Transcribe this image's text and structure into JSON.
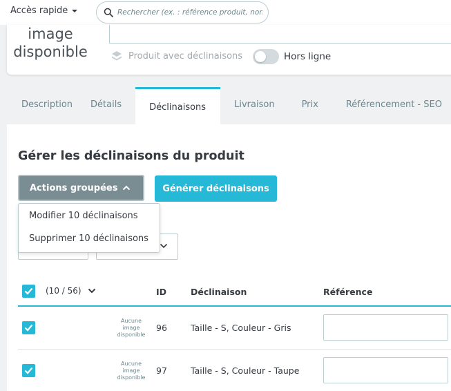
{
  "topbar": {
    "quick_access_label": "Accès rapide",
    "search_placeholder": "Rechercher (ex. : référence produit, nom du client…)"
  },
  "product_card": {
    "no_image_line1": "image",
    "no_image_line2": "disponible",
    "variants_option_label": "Produit avec déclinaisons",
    "offline_toggle_label": "Hors ligne",
    "offline_toggle_on": false
  },
  "tabs": [
    {
      "label": "Description",
      "active": false
    },
    {
      "label": "Détails",
      "active": false
    },
    {
      "label": "Déclinaisons",
      "active": true
    },
    {
      "label": "Livraison",
      "active": false
    },
    {
      "label": "Prix",
      "active": false
    },
    {
      "label": "Référencement - SEO",
      "active": false
    }
  ],
  "combinations": {
    "title": "Gérer les déclinaisons du produit",
    "bulk_actions_label": "Actions groupées",
    "generate_label": "Générer déclinaisons",
    "bulk_menu": {
      "edit_label": "Modifier 10 déclinaisons",
      "delete_label": "Supprimer 10 déclinaisons"
    },
    "table": {
      "selection_count": "(10 / 56)",
      "headers": {
        "id": "ID",
        "combination": "Déclinaison",
        "reference": "Référence"
      },
      "rows": [
        {
          "no_image_l1": "Aucune",
          "no_image_l2": "image",
          "no_image_l3": "disponible",
          "id": "96",
          "name": "Taille - S, Couleur - Gris",
          "reference": ""
        },
        {
          "no_image_l1": "Aucune",
          "no_image_l2": "image",
          "no_image_l3": "disponible",
          "id": "97",
          "name": "Taille - S, Couleur - Taupe",
          "reference": ""
        }
      ]
    }
  },
  "colors": {
    "accent": "#25b9d7",
    "bulk_button": "#7a8d93",
    "background": "#eff1f2",
    "text": "#363a41"
  }
}
